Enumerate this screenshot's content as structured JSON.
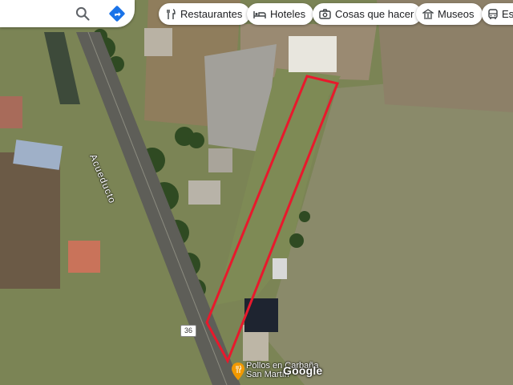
{
  "search": {
    "search_icon": "search-icon",
    "directions_icon": "directions-icon",
    "accent": "#1a73e8"
  },
  "chips": [
    {
      "label": "Restaurantes",
      "icon": "fork-knife-icon"
    },
    {
      "label": "Hoteles",
      "icon": "bed-icon"
    },
    {
      "label": "Cosas que hacer",
      "icon": "camera-icon"
    },
    {
      "label": "Museos",
      "icon": "museum-icon"
    },
    {
      "label": "Est",
      "icon": "bus-icon"
    }
  ],
  "map": {
    "road_name": "Acueducto",
    "route_shield": "36",
    "poi": {
      "name_line1": "Pollos en Carbaña",
      "name_line2": "San Martín",
      "icon": "fork-knife-pin-icon"
    },
    "logo": "Google",
    "outline_color": "#e8192c"
  }
}
